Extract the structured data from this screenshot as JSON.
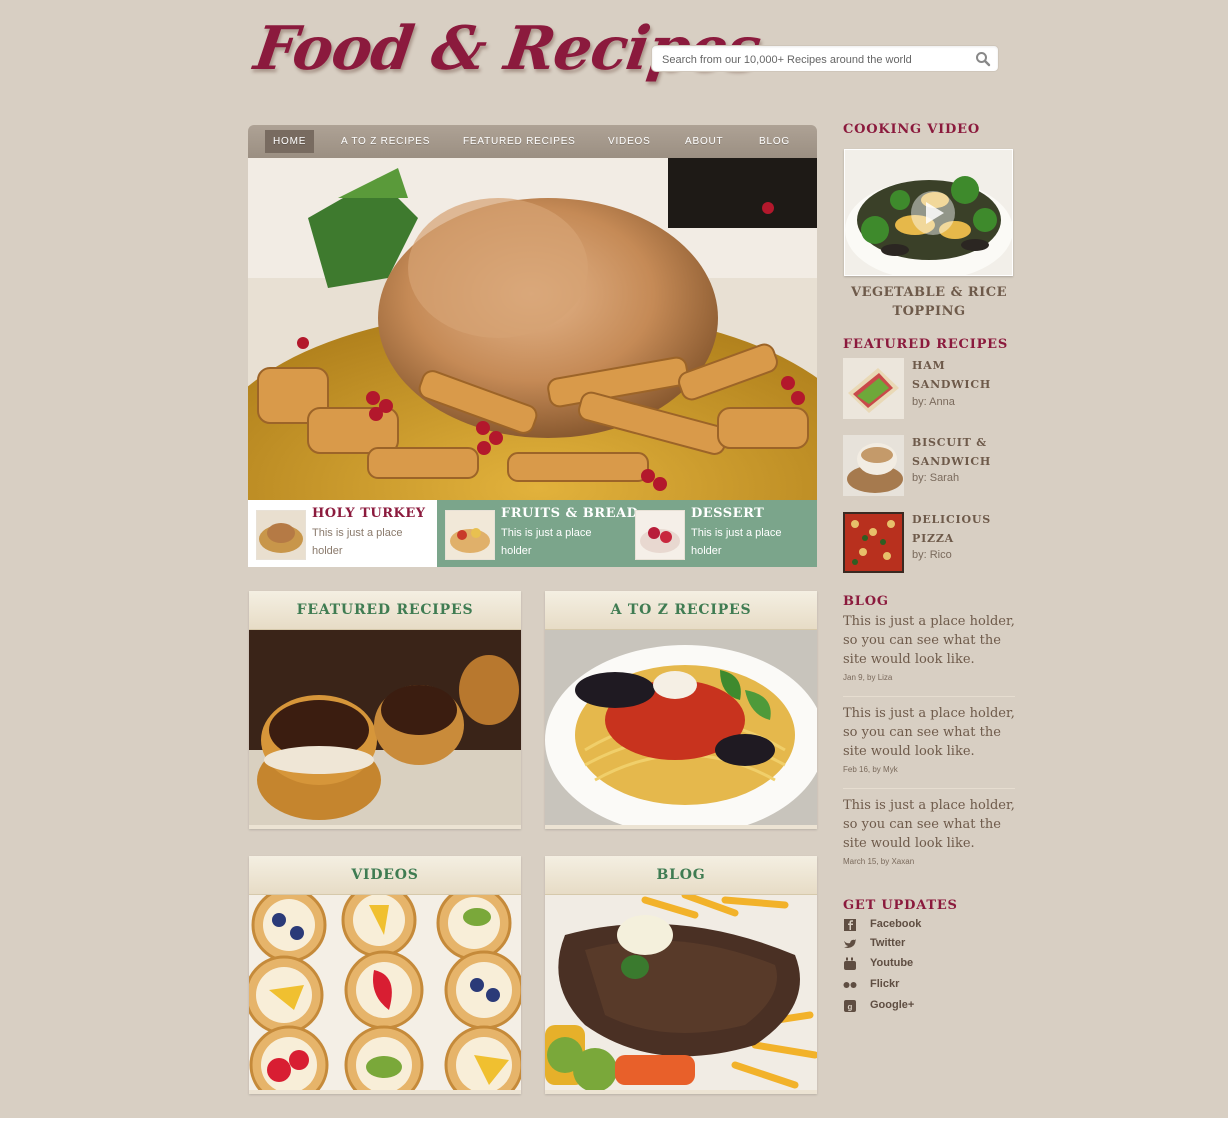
{
  "header": {
    "logo": "Food & Recipes",
    "search_placeholder": "Search from our 10,000+ Recipes around the world"
  },
  "nav": {
    "items": [
      {
        "label": "HOME",
        "active": true
      },
      {
        "label": "A TO Z RECIPES"
      },
      {
        "label": "FEATURED RECIPES"
      },
      {
        "label": "VIDEOS"
      },
      {
        "label": "ABOUT"
      },
      {
        "label": "BLOG"
      }
    ]
  },
  "strip": [
    {
      "title": "HOLY TURKEY",
      "text": "This is just a place holder"
    },
    {
      "title": "FRUITS & BREAD",
      "text": "This is just a place holder"
    },
    {
      "title": "DESSERT",
      "text": "This is just a place holder"
    }
  ],
  "sections": [
    {
      "title": "FEATURED RECIPES"
    },
    {
      "title": "A TO Z RECIPES"
    },
    {
      "title": "VIDEOS"
    },
    {
      "title": "BLOG"
    }
  ],
  "sidebar": {
    "cooking_video": {
      "heading": "COOKING VIDEO",
      "title": "VEGETABLE & RICE TOPPING"
    },
    "featured": {
      "heading": "FEATURED RECIPES",
      "items": [
        {
          "title": "HAM SANDWICH",
          "by": "by: Anna"
        },
        {
          "title": "BISCUIT & SANDWICH",
          "by": "by: Sarah"
        },
        {
          "title": "DELICIOUS PIZZA",
          "by": "by: Rico"
        }
      ]
    },
    "blog": {
      "heading": "BLOG",
      "posts": [
        {
          "text": "This is just a place holder, so you can see what the site would look like.",
          "meta": "Jan 9, by Liza"
        },
        {
          "text": "This is just a place holder, so you can see what the site would look like.",
          "meta": "Feb 16, by Myk"
        },
        {
          "text": "This is just a place holder, so you can see what the site would look like.",
          "meta": "March 15, by Xaxan"
        }
      ]
    },
    "updates": {
      "heading": "GET UPDATES",
      "links": [
        {
          "label": "Facebook",
          "icon": "facebook-icon"
        },
        {
          "label": "Twitter",
          "icon": "twitter-icon"
        },
        {
          "label": "Youtube",
          "icon": "youtube-icon"
        },
        {
          "label": "Flickr",
          "icon": "flickr-icon"
        },
        {
          "label": "Google+",
          "icon": "google-plus-icon"
        }
      ]
    }
  },
  "colors": {
    "background": "#d8cfc3",
    "brand": "#8b1a3d",
    "accent_green": "#3f7c52",
    "strip_green": "#7ba58b"
  }
}
